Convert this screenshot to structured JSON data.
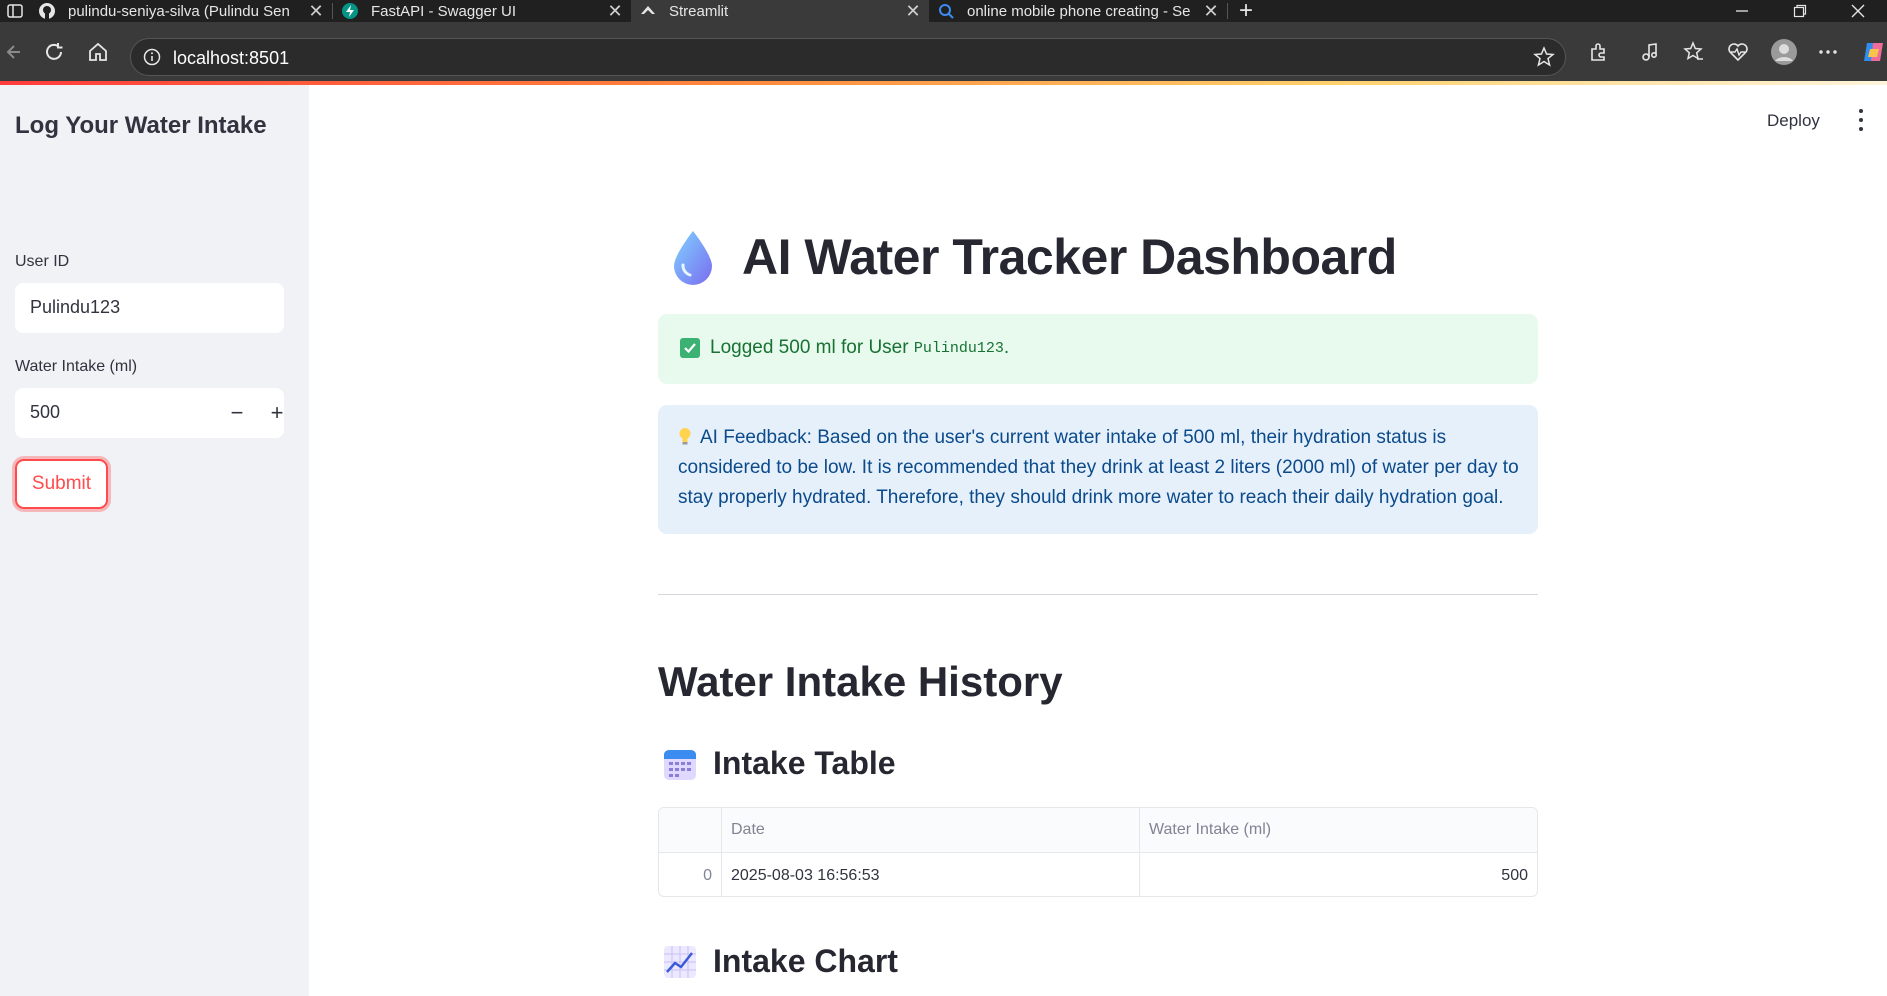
{
  "browser": {
    "tabs": [
      {
        "title": "pulindu-seniya-silva (Pulindu Sen",
        "icon": "github-icon",
        "active": false
      },
      {
        "title": "FastAPI - Swagger UI",
        "icon": "fastapi-icon",
        "active": false
      },
      {
        "title": "Streamlit",
        "icon": "streamlit-icon",
        "active": true
      },
      {
        "title": "online mobile phone creating - Se",
        "icon": "search-icon",
        "active": false
      }
    ],
    "url": "localhost:8501"
  },
  "header": {
    "deploy_label": "Deploy"
  },
  "sidebar": {
    "title": "Log Your Water Intake",
    "user_id_label": "User ID",
    "user_id_value": "Pulindu123",
    "water_label": "Water Intake (ml)",
    "water_value": "500",
    "submit_label": "Submit"
  },
  "main": {
    "title": "AI Water Tracker Dashboard",
    "success": {
      "text_before": "Logged 500 ml for User ",
      "code": "Pulindu123",
      "text_after": "."
    },
    "info_text": "AI Feedback: Based on the user's current water intake of 500 ml, their hydration status is considered to be low. It is recommended that they drink at least 2 liters (2000 ml) of water per day to stay properly hydrated. Therefore, they should drink more water to reach their daily hydration goal.",
    "history_title": "Water Intake History",
    "table_title": "Intake Table",
    "chart_title": "Intake Chart",
    "table": {
      "columns": [
        "",
        "Date",
        "Water Intake (ml)"
      ],
      "rows": [
        {
          "index": "0",
          "date": "2025-08-03 16:56:53",
          "intake": "500"
        }
      ]
    }
  },
  "colors": {
    "primary": "#ff4b4b",
    "success_bg": "#e8f9ee",
    "info_bg": "#e6f0fb",
    "sidebar_bg": "#f0f2f6"
  }
}
